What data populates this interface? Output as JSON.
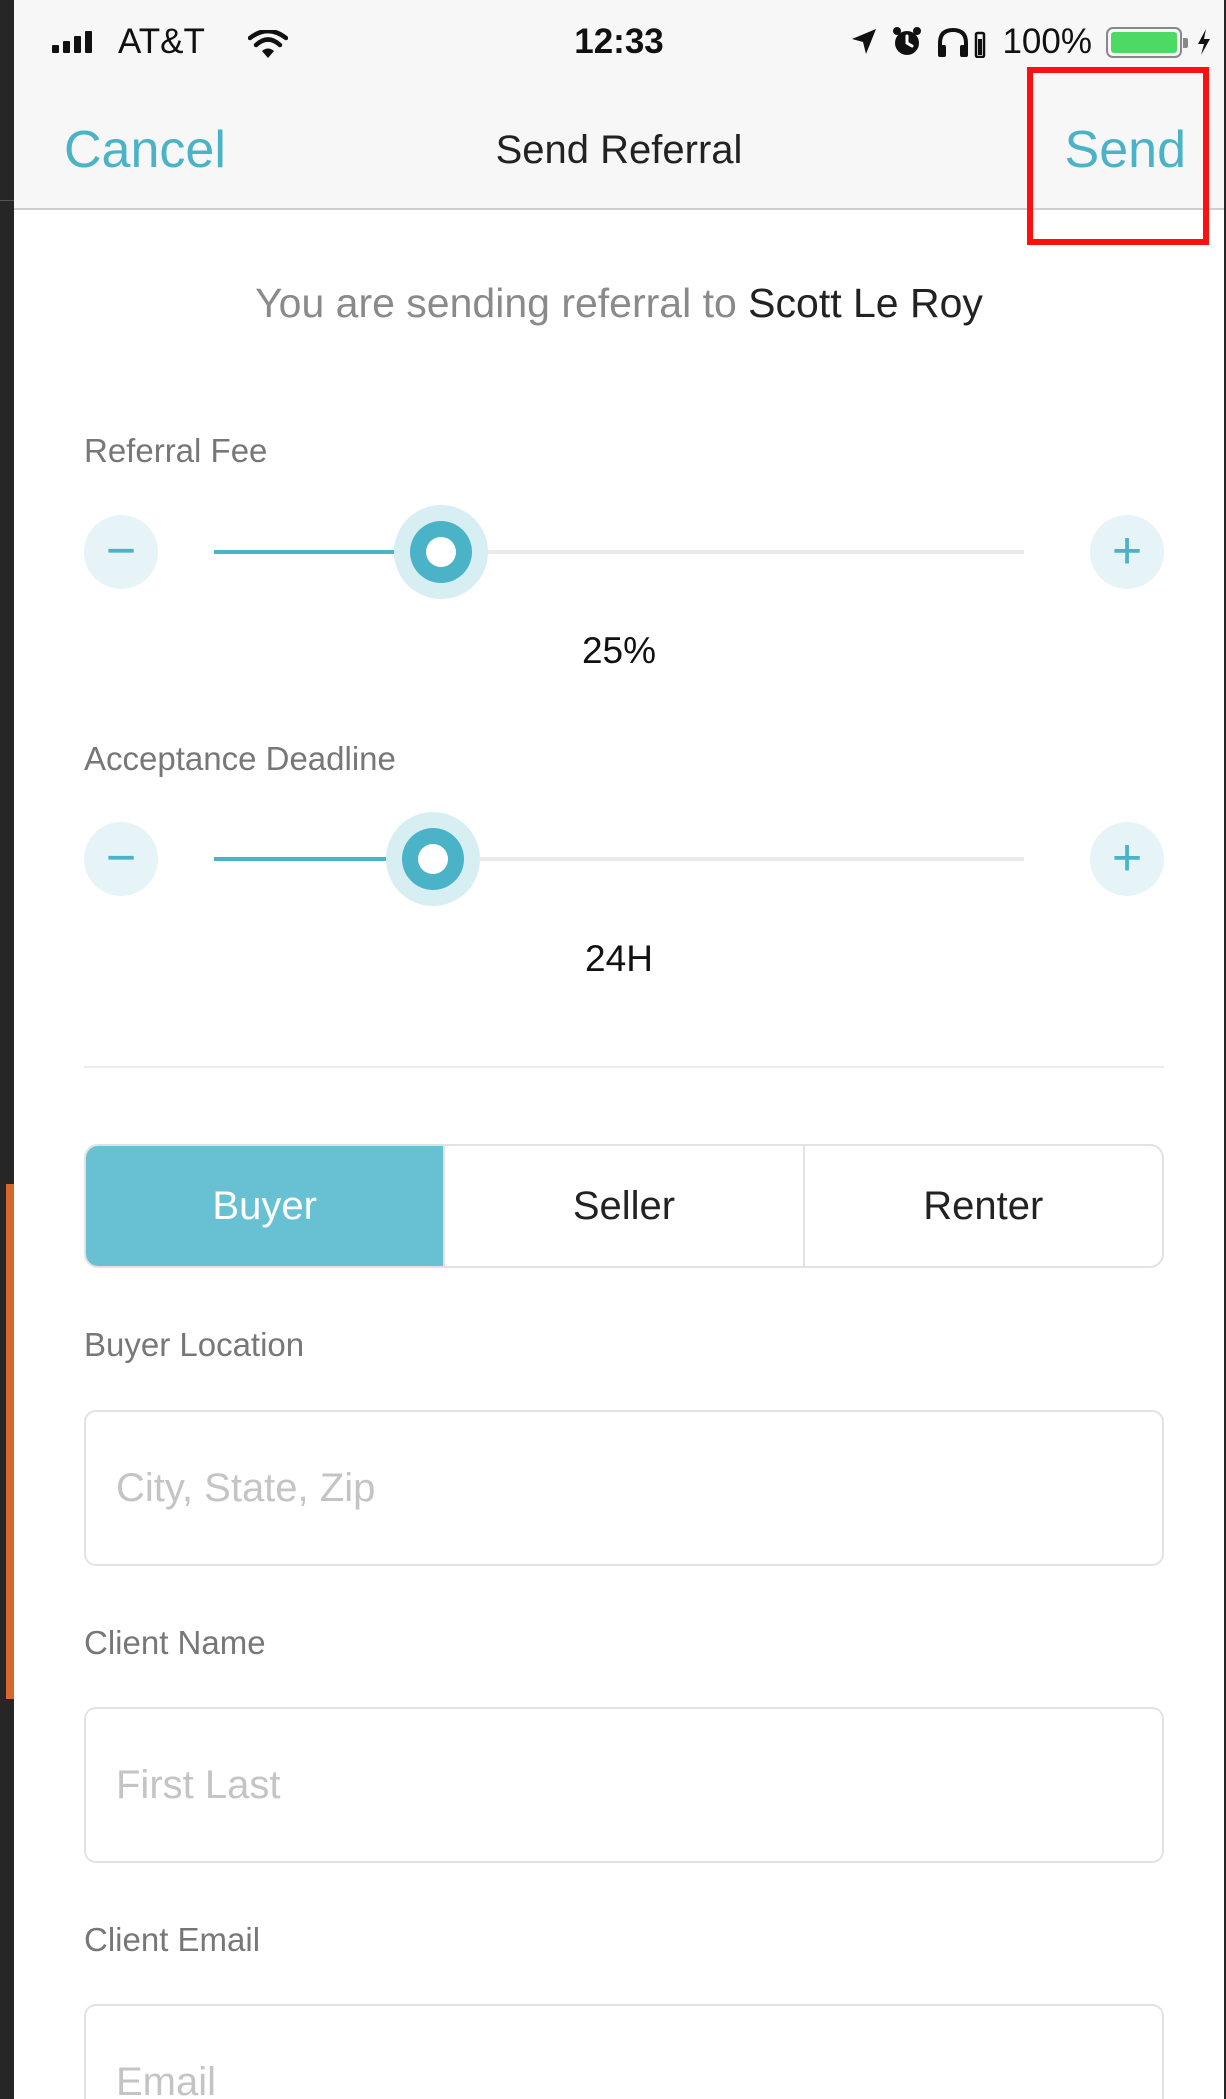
{
  "status_bar": {
    "carrier": "AT&T",
    "time": "12:33",
    "battery_pct": "100%",
    "battery_level": 1.0,
    "battery_color": "#4cd964"
  },
  "nav": {
    "cancel_label": "Cancel",
    "title": "Send Referral",
    "send_label": "Send",
    "accent_color": "#4ab3c7",
    "highlight_color": "#ff1010"
  },
  "intro": {
    "prefix": "You are sending referral to ",
    "recipient": "Scott Le Roy"
  },
  "referral_fee": {
    "label": "Referral Fee",
    "value_text": "25%",
    "position": 0.28,
    "minus_icon": "minus-icon",
    "plus_icon": "plus-icon"
  },
  "acceptance_deadline": {
    "label": "Acceptance Deadline",
    "value_text": "24H",
    "position": 0.27,
    "minus_icon": "minus-icon",
    "plus_icon": "plus-icon"
  },
  "client_type": {
    "options": [
      "Buyer",
      "Seller",
      "Renter"
    ],
    "selected": "Buyer",
    "active_color": "#68c1d2"
  },
  "buyer_location": {
    "label": "Buyer Location",
    "value": "",
    "placeholder": "City, State, Zip"
  },
  "client_name": {
    "label": "Client Name",
    "value": "",
    "placeholder": "First Last"
  },
  "client_email": {
    "label": "Client Email",
    "value": "",
    "placeholder": "Email"
  }
}
